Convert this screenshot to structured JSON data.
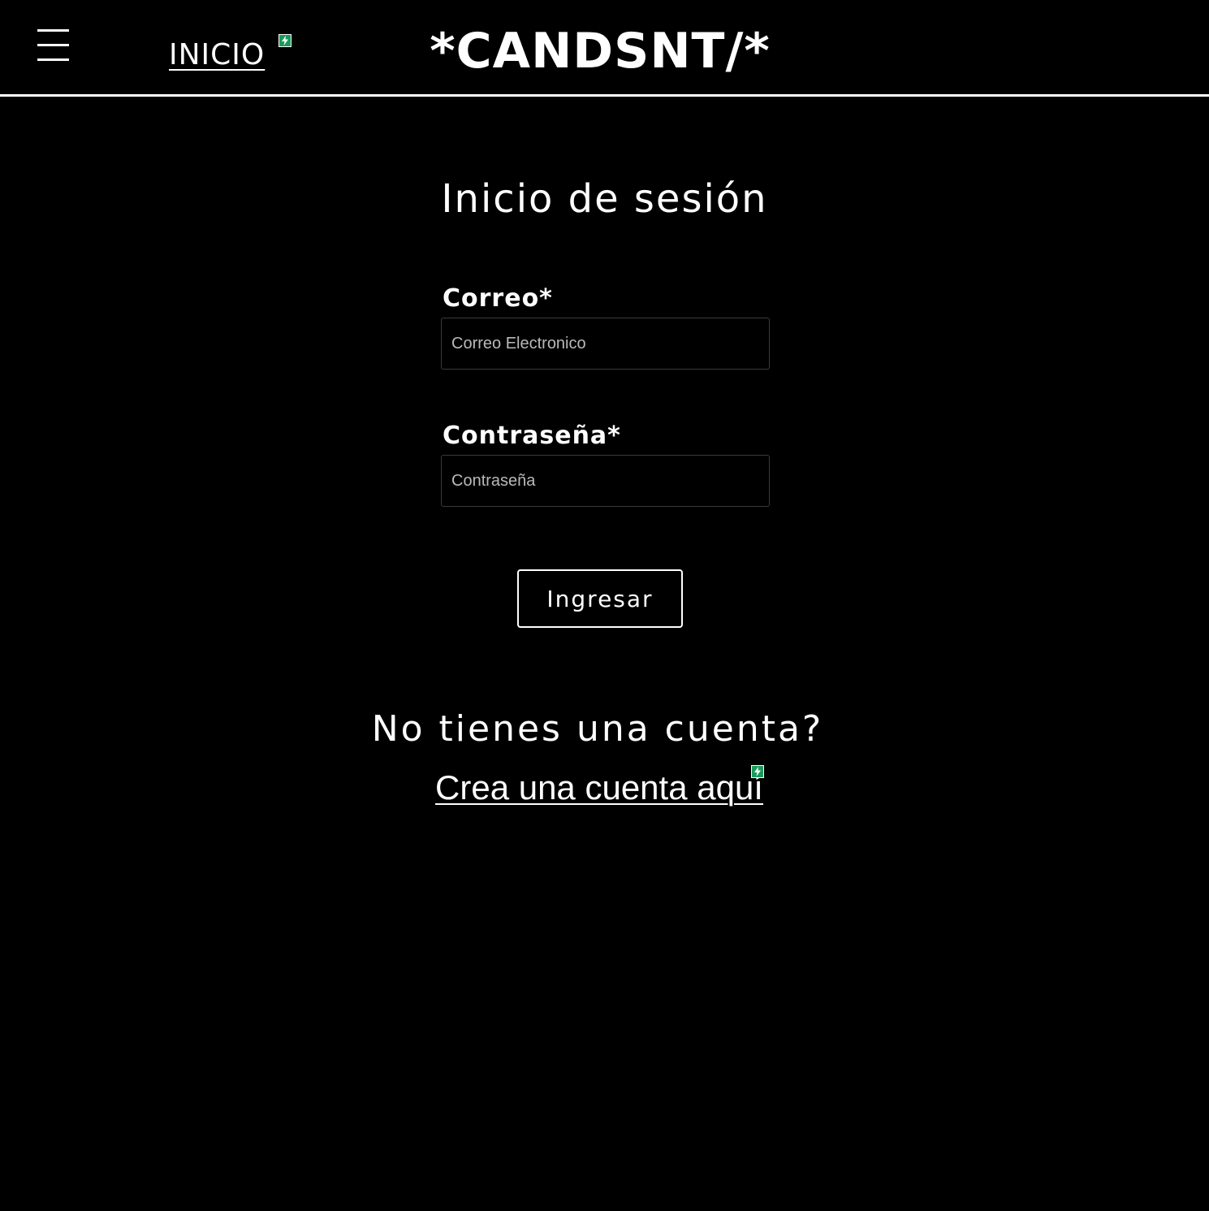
{
  "header": {
    "menu_icon": "hamburger-menu-icon",
    "nav_home_label": "INICIO",
    "brand": "*CANDSNT/*"
  },
  "login": {
    "title": "Inicio de sesión",
    "email": {
      "label": "Correo*",
      "placeholder": "Correo Electronico",
      "value": ""
    },
    "password": {
      "label": "Contraseña*",
      "placeholder": "Contraseña",
      "value": ""
    },
    "submit_label": "Ingresar"
  },
  "signup": {
    "prompt": "No tienes una cuenta?",
    "link_label": "Crea una cuenta aquí"
  },
  "colors": {
    "background": "#000000",
    "foreground": "#ffffff",
    "badge": "#1a9a5a"
  },
  "icons": [
    "hamburger-menu-icon",
    "lightning-badge-icon"
  ]
}
